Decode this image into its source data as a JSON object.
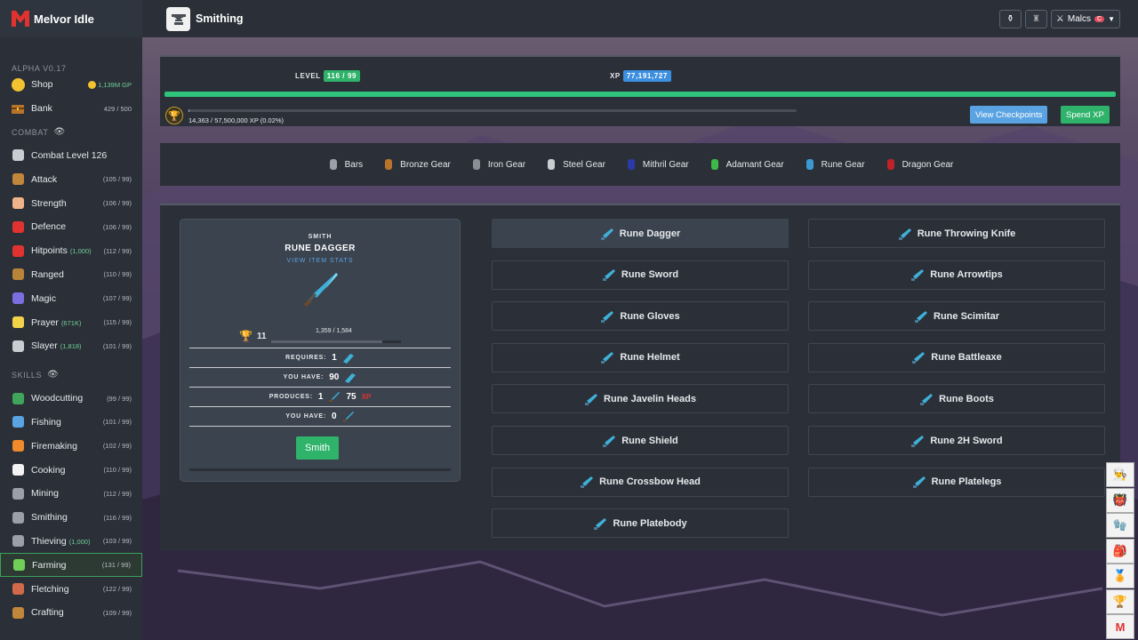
{
  "app": {
    "name": "Melvor Idle",
    "version": "ALPHA V0.17"
  },
  "page": {
    "title": "Smithing"
  },
  "topbar": {
    "user": "Malcs",
    "badge": "C"
  },
  "sidebar": {
    "shop": {
      "label": "Shop",
      "gp": "1,139M GP"
    },
    "bank": {
      "label": "Bank",
      "value": "429 / 500"
    },
    "combat_header": "COMBAT",
    "combat": [
      {
        "label": "Combat Level 126",
        "sub": "",
        "level": "",
        "icon": "swords-icon",
        "color": "#c9ccd1"
      },
      {
        "label": "Attack",
        "sub": "",
        "level": "(105 / 99)",
        "icon": "sword-icon",
        "color": "#c0873a"
      },
      {
        "label": "Strength",
        "sub": "",
        "level": "(106 / 99)",
        "icon": "arm-icon",
        "color": "#f0b48a"
      },
      {
        "label": "Defence",
        "sub": "",
        "level": "(106 / 99)",
        "icon": "shield-icon",
        "color": "#e0332f"
      },
      {
        "label": "Hitpoints",
        "sub": "(1,000)",
        "level": "(112 / 99)",
        "icon": "heart-icon",
        "color": "#e0332f"
      },
      {
        "label": "Ranged",
        "sub": "",
        "level": "(110 / 99)",
        "icon": "bow-icon",
        "color": "#b8843a"
      },
      {
        "label": "Magic",
        "sub": "",
        "level": "(107 / 99)",
        "icon": "wizard-hat-icon",
        "color": "#7a6ee0"
      },
      {
        "label": "Prayer",
        "sub": "(671K)",
        "level": "(115 / 99)",
        "icon": "star-icon",
        "color": "#f2d24a"
      },
      {
        "label": "Slayer",
        "sub": "(1,818)",
        "level": "(101 / 99)",
        "icon": "slayer-icon",
        "color": "#c9ccd1"
      }
    ],
    "skills_header": "SKILLS",
    "skills": [
      {
        "label": "Woodcutting",
        "sub": "",
        "level": "(99 / 99)",
        "icon": "tree-icon",
        "color": "#3fa55a",
        "active": false
      },
      {
        "label": "Fishing",
        "sub": "",
        "level": "(101 / 99)",
        "icon": "fish-icon",
        "color": "#5aa3e2",
        "active": false
      },
      {
        "label": "Firemaking",
        "sub": "",
        "level": "(102 / 99)",
        "icon": "fire-icon",
        "color": "#f08a2a",
        "active": false
      },
      {
        "label": "Cooking",
        "sub": "",
        "level": "(110 / 99)",
        "icon": "chef-hat-icon",
        "color": "#f3f3f3",
        "active": false
      },
      {
        "label": "Mining",
        "sub": "",
        "level": "(112 / 99)",
        "icon": "pickaxe-icon",
        "color": "#9aa0a8",
        "active": false
      },
      {
        "label": "Smithing",
        "sub": "",
        "level": "(116 / 99)",
        "icon": "anvil-icon",
        "color": "#9aa0a8",
        "active": false
      },
      {
        "label": "Thieving",
        "sub": "(1,000)",
        "level": "(103 / 99)",
        "icon": "thief-icon",
        "color": "#9aa0a8",
        "active": false
      },
      {
        "label": "Farming",
        "sub": "",
        "level": "(131 / 99)",
        "icon": "sprout-icon",
        "color": "#6fcf57",
        "active": true
      },
      {
        "label": "Fletching",
        "sub": "",
        "level": "(122 / 99)",
        "icon": "arrow-icon",
        "color": "#d06a4a",
        "active": false
      },
      {
        "label": "Crafting",
        "sub": "",
        "level": "(109 / 99)",
        "icon": "tools-icon",
        "color": "#c0873a",
        "active": false
      }
    ]
  },
  "xp_panel": {
    "level_label": "LEVEL",
    "level_value": "116 / 99",
    "xp_label": "XP",
    "xp_value": "77,191,727",
    "level_progress": 1.0,
    "mastery_pool": "14,363 / 57,500,000 XP (0.02%)",
    "mastery_pool_progress": 0.0002,
    "view_checkpoints": "View Checkpoints",
    "spend_xp": "Spend XP"
  },
  "categories": [
    {
      "label": "Bars",
      "icon": "bar-icon",
      "color": "#9aa0a8"
    },
    {
      "label": "Bronze Gear",
      "icon": "bronze-armour-icon",
      "color": "#b8742a"
    },
    {
      "label": "Iron Gear",
      "icon": "iron-armour-icon",
      "color": "#8a8f96"
    },
    {
      "label": "Steel Gear",
      "icon": "steel-armour-icon",
      "color": "#c9ccd1"
    },
    {
      "label": "Mithril Gear",
      "icon": "mithril-armour-icon",
      "color": "#2a3aa8"
    },
    {
      "label": "Adamant Gear",
      "icon": "adamant-armour-icon",
      "color": "#3fb84a"
    },
    {
      "label": "Rune Gear",
      "icon": "rune-armour-icon",
      "color": "#3a9ad0"
    },
    {
      "label": "Dragon Gear",
      "icon": "dragon-armour-icon",
      "color": "#c0222a"
    }
  ],
  "craft": {
    "header": "SMITH",
    "item": "RUNE DAGGER",
    "view_stats": "VIEW ITEM STATS",
    "mastery_level": "11",
    "mastery_progress": "1,359 / 1,584",
    "mastery_fraction": 0.858,
    "requires_label": "REQUIRES:",
    "requires_qty": "1",
    "you_have_label": "YOU HAVE:",
    "you_have_bar": "90",
    "produces_label": "PRODUCES:",
    "produces_qty": "1",
    "produces_xp": "75",
    "xp_label": "XP",
    "you_have_label_2": "YOU HAVE:",
    "you_have_item": "0",
    "smith_button": "Smith"
  },
  "recipes": [
    {
      "label": "Rune Dagger",
      "icon": "dagger-icon",
      "selected": true
    },
    {
      "label": "Rune Throwing Knife",
      "icon": "throwing-knife-icon",
      "selected": false
    },
    {
      "label": "Rune Sword",
      "icon": "sword-icon",
      "selected": false
    },
    {
      "label": "Rune Arrowtips",
      "icon": "arrowtips-icon",
      "selected": false
    },
    {
      "label": "Rune Gloves",
      "icon": "gloves-icon",
      "selected": false
    },
    {
      "label": "Rune Scimitar",
      "icon": "scimitar-icon",
      "selected": false
    },
    {
      "label": "Rune Helmet",
      "icon": "helmet-icon",
      "selected": false
    },
    {
      "label": "Rune Battleaxe",
      "icon": "battleaxe-icon",
      "selected": false
    },
    {
      "label": "Rune Javelin Heads",
      "icon": "javelin-heads-icon",
      "selected": false
    },
    {
      "label": "Rune Boots",
      "icon": "boots-icon",
      "selected": false
    },
    {
      "label": "Rune Shield",
      "icon": "shield-icon",
      "selected": false
    },
    {
      "label": "Rune 2H Sword",
      "icon": "two-hand-sword-icon",
      "selected": false
    },
    {
      "label": "Rune Crossbow Head",
      "icon": "crossbow-head-icon",
      "selected": false
    },
    {
      "label": "Rune Platelegs",
      "icon": "platelegs-icon",
      "selected": false
    },
    {
      "label": "Rune Platebody",
      "icon": "platebody-icon",
      "selected": false
    }
  ],
  "dock": [
    {
      "icon": "chef-icon",
      "glyph": "👨‍🍳"
    },
    {
      "icon": "monster-icon",
      "glyph": "👹"
    },
    {
      "icon": "glove-icon",
      "glyph": "🧤"
    },
    {
      "icon": "bag-icon",
      "glyph": "🎒"
    },
    {
      "icon": "medal-icon",
      "glyph": "🏅"
    },
    {
      "icon": "trophy-icon",
      "glyph": "🏆"
    },
    {
      "icon": "melvor-logo-icon",
      "glyph": "M"
    }
  ]
}
